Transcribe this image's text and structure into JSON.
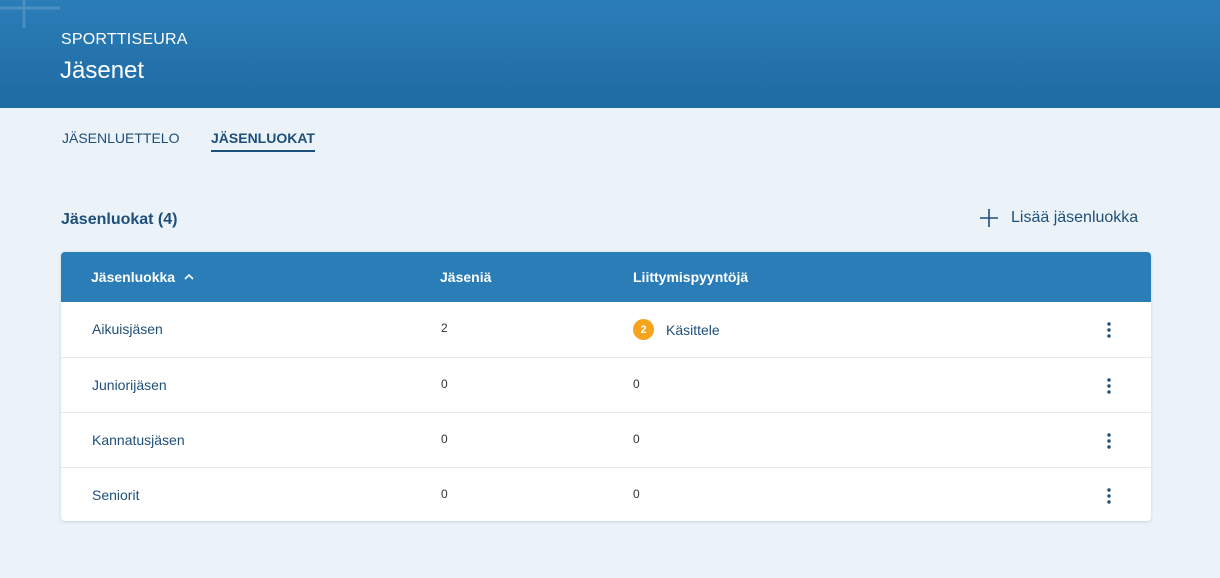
{
  "header": {
    "org": "SPORTTISEURA",
    "title": "Jäsenet"
  },
  "tabs": [
    {
      "label": "JÄSENLUETTELO",
      "active": false
    },
    {
      "label": "JÄSENLUOKAT",
      "active": true
    }
  ],
  "section": {
    "title": "Jäsenluokat (4)",
    "add_label": "Lisää jäsenluokka"
  },
  "table": {
    "columns": [
      "Jäsenluokka",
      "Jäseniä",
      "Liittymispyyntöjä"
    ],
    "sort_icon": "chevron-up-icon",
    "rows": [
      {
        "name": "Aikuisjäsen",
        "members": "2",
        "requests": "2",
        "action": "Käsittele"
      },
      {
        "name": "Juniorijäsen",
        "members": "0",
        "requests": "0"
      },
      {
        "name": "Kannatusjäsen",
        "members": "0",
        "requests": "0"
      },
      {
        "name": "Seniorit",
        "members": "0",
        "requests": "0"
      }
    ]
  },
  "colors": {
    "header_bg": "#2379b4",
    "accent": "#1e4f7a",
    "badge": "#f5a41c",
    "page_bg": "#ebf3f9"
  }
}
